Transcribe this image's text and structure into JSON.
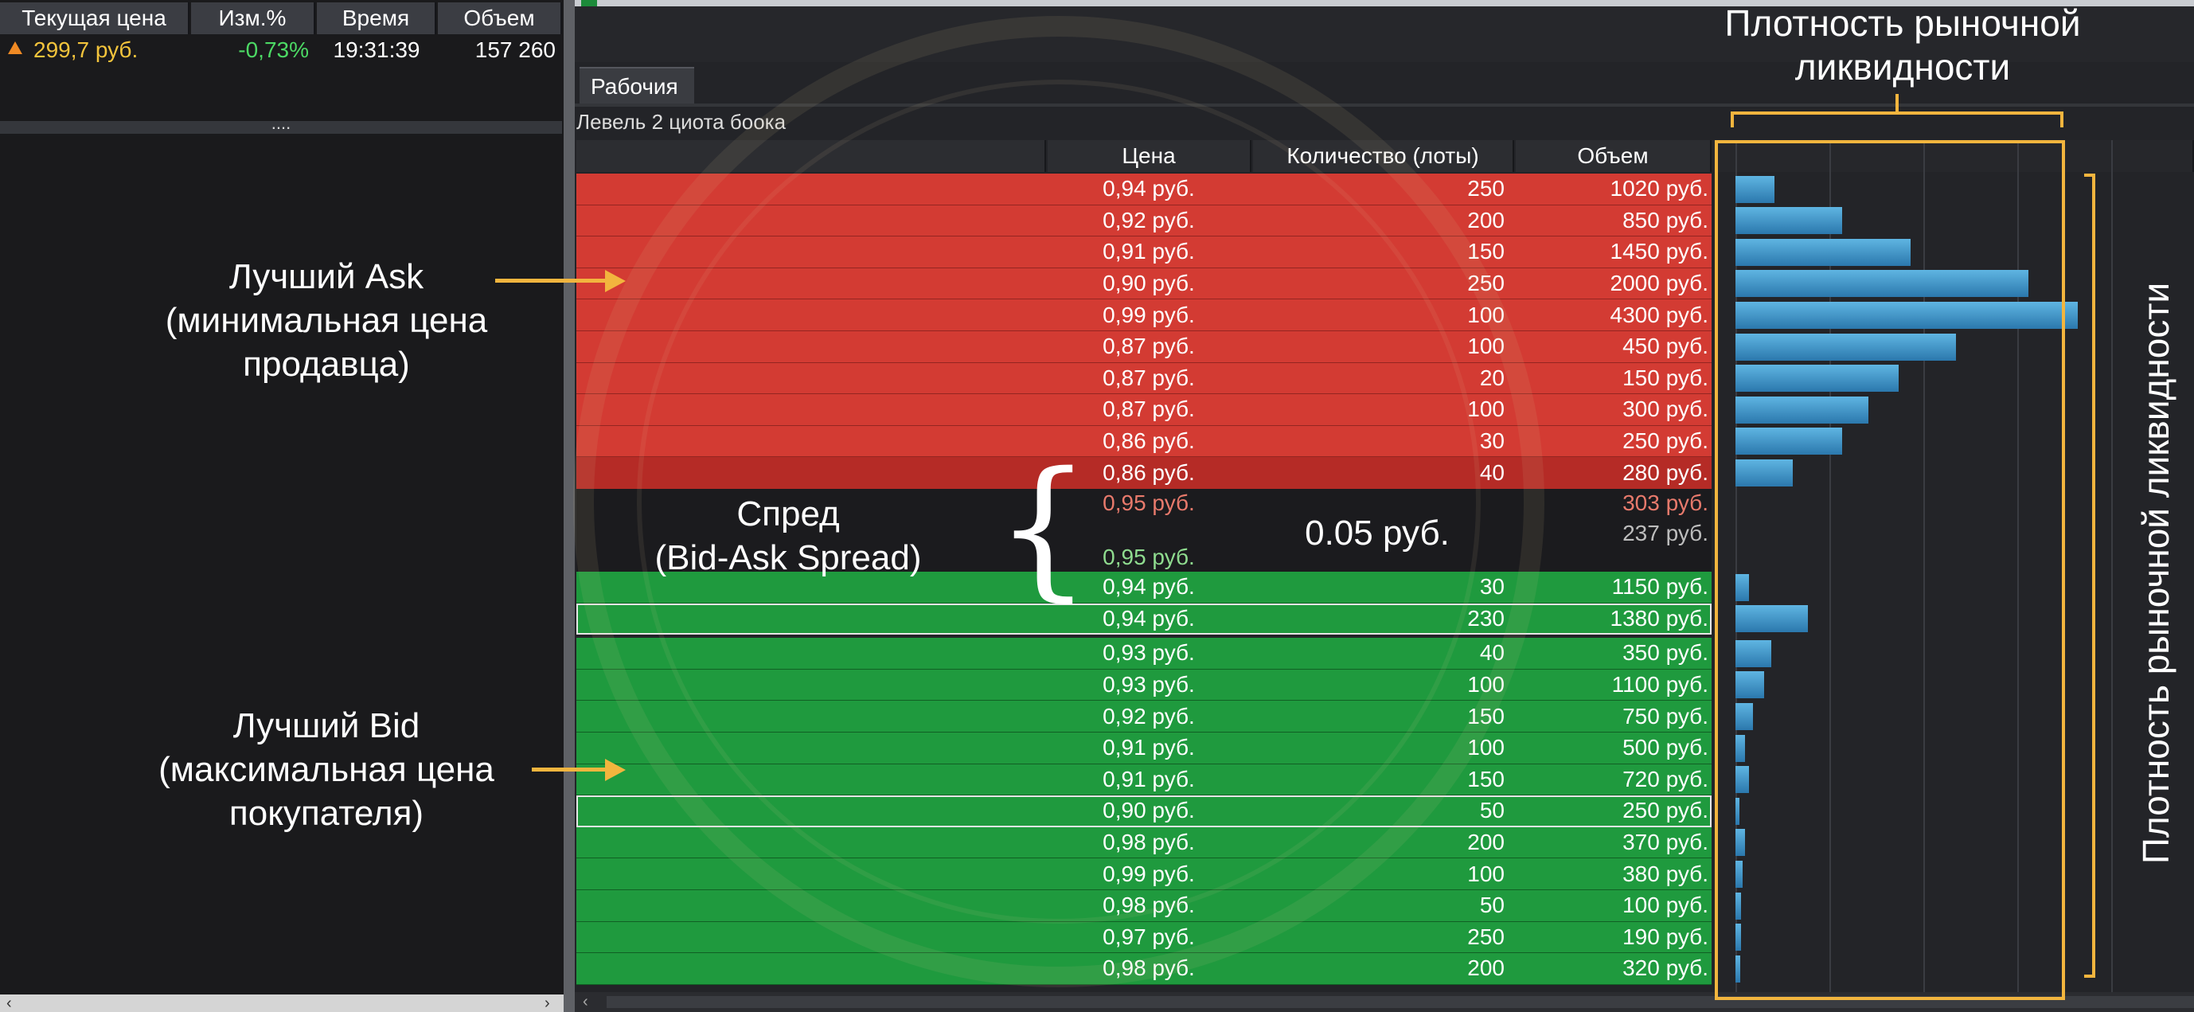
{
  "left_quote": {
    "columns": [
      "Текущая цена",
      "Изм.%",
      "Время",
      "Объем"
    ],
    "row": {
      "price": "299,7 руб.",
      "change": "-0,73%",
      "time": "19:31:39",
      "volume": "157 260"
    },
    "splitter_grip": "....",
    "scroll_left": "‹",
    "scroll_right": "›"
  },
  "order_book": {
    "tab": "Рабочия",
    "title": "Левель 2 циота боока",
    "columns": [
      "Цена",
      "Количество (лоты)",
      "Объем"
    ],
    "asks": [
      {
        "price": "0,94 руб.",
        "qty": "250",
        "volume": "1020 руб.",
        "density": 1020
      },
      {
        "price": "0,92 руб.",
        "qty": "200",
        "volume": "850 руб.",
        "density": 2800
      },
      {
        "price": "0,91 руб.",
        "qty": "150",
        "volume": "1450 руб.",
        "density": 4600
      },
      {
        "price": "0,90 руб.",
        "qty": "250",
        "volume": "2000 руб.",
        "density": 7700
      },
      {
        "price": "0,99 руб.",
        "qty": "100",
        "volume": "4300 руб.",
        "density": 9000
      },
      {
        "price": "0,87 руб.",
        "qty": "100",
        "volume": "450 руб.",
        "density": 5800
      },
      {
        "price": "0,87 руб.",
        "qty": "20",
        "volume": "150 руб.",
        "density": 4300
      },
      {
        "price": "0,87 руб.",
        "qty": "100",
        "volume": "300 руб.",
        "density": 3500
      },
      {
        "price": "0,86 руб.",
        "qty": "30",
        "volume": "250 руб.",
        "density": 2800
      },
      {
        "price": "0,86 руб.",
        "qty": "40",
        "volume": "280 руб.",
        "density": 1500
      }
    ],
    "spread_rows": [
      {
        "price": "0,95 руб.",
        "volume": "303 руб."
      },
      {
        "price": "",
        "volume": "237 руб."
      },
      {
        "price": "0,95 руб.",
        "volume": ""
      }
    ],
    "bids": [
      {
        "price": "0,94 руб.",
        "qty": "30",
        "volume": "1150 руб.",
        "density": 350,
        "selected": false
      },
      {
        "price": "0,94 руб.",
        "qty": "230",
        "volume": "1380 руб.",
        "density": 1900,
        "selected": true
      },
      {
        "price": "0,93 руб.",
        "qty": "40",
        "volume": "350 руб.",
        "density": 950,
        "selected": false
      },
      {
        "price": "0,93 руб.",
        "qty": "100",
        "volume": "1100 руб.",
        "density": 750,
        "selected": false
      },
      {
        "price": "0,92 руб.",
        "qty": "150",
        "volume": "750 руб.",
        "density": 450,
        "selected": false
      },
      {
        "price": "0,91 руб.",
        "qty": "100",
        "volume": "500 руб.",
        "density": 250,
        "selected": false
      },
      {
        "price": "0,91 руб.",
        "qty": "150",
        "volume": "720 руб.",
        "density": 350,
        "selected": false
      },
      {
        "price": "0,90 руб.",
        "qty": "50",
        "volume": "250 руб.",
        "density": 100,
        "selected": true
      },
      {
        "price": "0,98 руб.",
        "qty": "200",
        "volume": "370 руб.",
        "density": 250,
        "selected": false
      },
      {
        "price": "0,99 руб.",
        "qty": "100",
        "volume": "380 руб.",
        "density": 180,
        "selected": false
      },
      {
        "price": "0,98 руб.",
        "qty": "50",
        "volume": "100 руб.",
        "density": 150,
        "selected": false
      },
      {
        "price": "0,97 руб.",
        "qty": "250",
        "volume": "190 руб.",
        "density": 150,
        "selected": false
      },
      {
        "price": "0,98 руб.",
        "qty": "200",
        "volume": "320 руб.",
        "density": 120,
        "selected": false
      }
    ],
    "density_max": 9000
  },
  "annotations": {
    "best_ask": [
      "Лучший Ask",
      "(минимальная цена",
      "продавца)"
    ],
    "best_bid": [
      "Лучший Bid",
      "(максимальная цена",
      "покупателя)"
    ],
    "spread": [
      "Спред",
      "(Bid-Ask Spread)"
    ],
    "spread_brace": "{",
    "spread_value": "0.05 руб.",
    "density_top": [
      "Плотность рыночной",
      "ликвидности"
    ],
    "density_side": "Плотность рыночной ликвидности"
  },
  "colors": {
    "ask": "#d33b33",
    "bid": "#1f9a3e",
    "highlight": "#f2b53e",
    "up_arrow": "#f08a24",
    "negative_change": "#4cd964",
    "price_text": "#f3c43c"
  }
}
